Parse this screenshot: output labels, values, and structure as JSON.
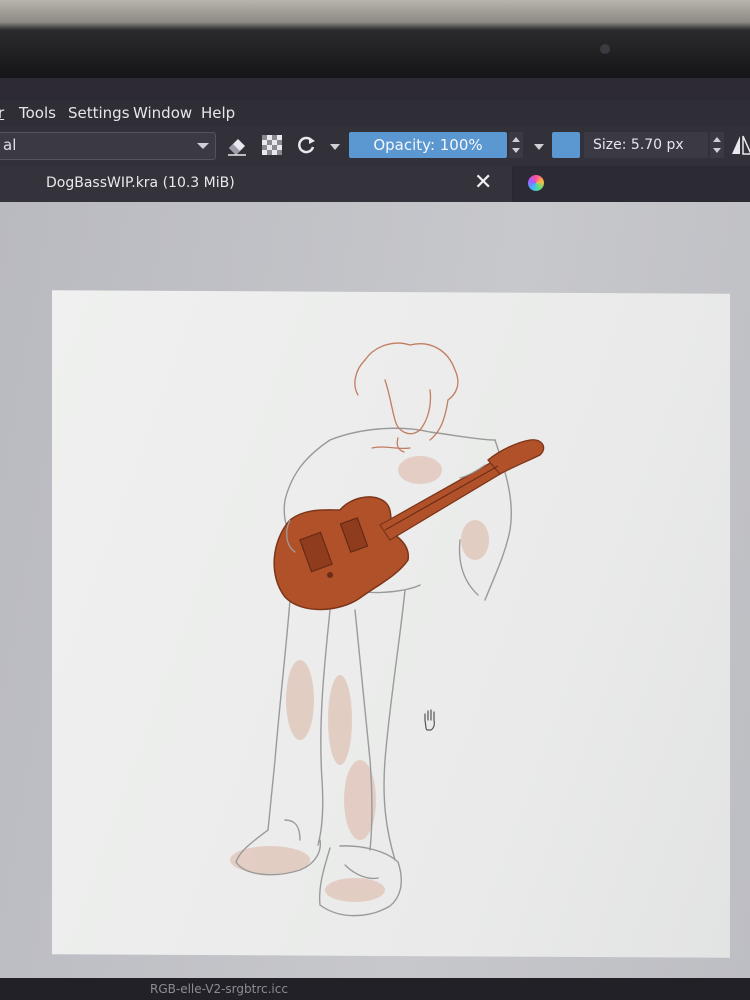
{
  "menu": {
    "items": [
      {
        "label": "r"
      },
      {
        "label": "Tools"
      },
      {
        "label": "Settings"
      },
      {
        "label": "Window"
      },
      {
        "label": "Help"
      }
    ]
  },
  "toolbar": {
    "blend_mode": "al",
    "opacity_label": "Opacity: 100%",
    "size_label": "Size: 5.70 px",
    "accent_color": "#5b97d1"
  },
  "tabs": {
    "document_title": "DogBassWIP.kra (10.3 MiB)",
    "close_icon": "close-icon",
    "app_logo": "krita-logo-icon"
  },
  "canvas": {
    "cursor_icon": "hand-pan-icon",
    "guitar_color": "#b0512a"
  },
  "status": {
    "color_profile": "RGB-elle-V2-srgbtrc.icc"
  }
}
